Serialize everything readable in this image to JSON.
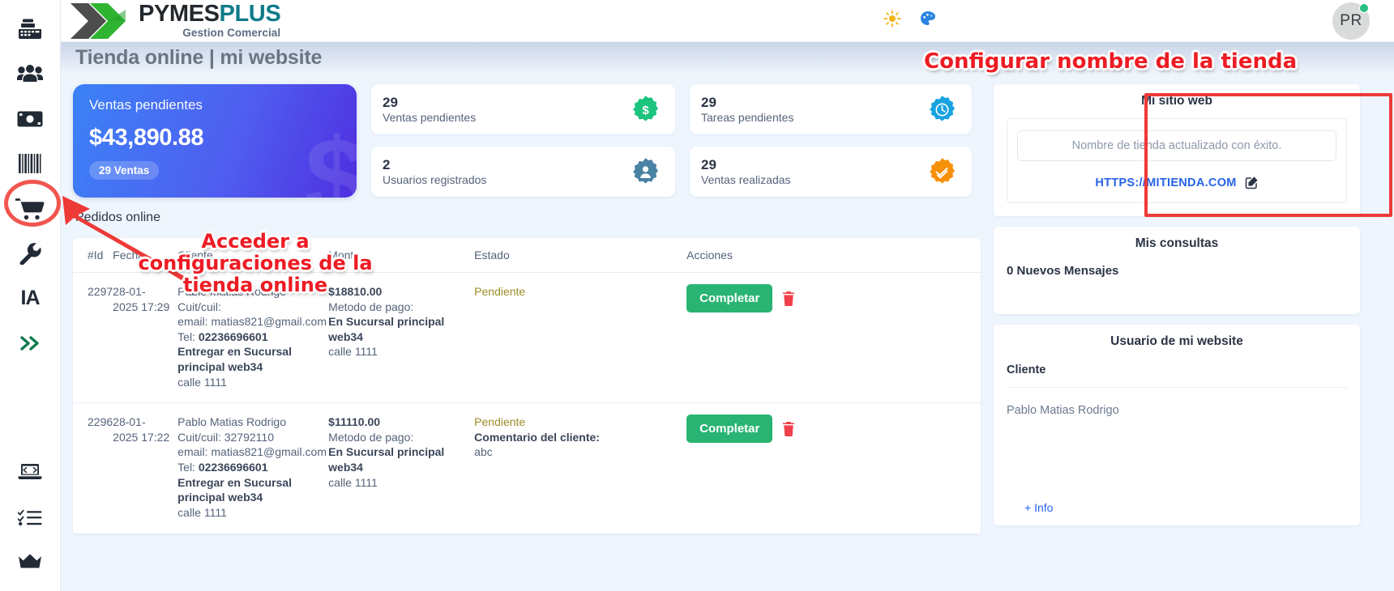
{
  "brand": {
    "name_part1": "PYMES",
    "name_part2": "PLUS",
    "tagline": "Gestion Comercial",
    "logo_icon": "double-chevron-logo-icon"
  },
  "topbar": {
    "theme_icon": "sun-icon",
    "palette_icon": "palette-icon",
    "avatar_initials": "PR",
    "avatar_status": "online"
  },
  "page": {
    "title": "Tienda online | mi website"
  },
  "sidebar": {
    "items": [
      {
        "name": "cash-register-icon",
        "label": "Caja"
      },
      {
        "name": "users-icon",
        "label": "Clientes"
      },
      {
        "name": "money-bill-icon",
        "label": "Ventas"
      },
      {
        "name": "barcode-icon",
        "label": "Productos"
      },
      {
        "name": "shopping-cart-icon",
        "label": "Tienda online",
        "active": true
      },
      {
        "name": "wrench-icon",
        "label": "Configuracion"
      },
      {
        "name": "ia-text-icon",
        "label": "IA"
      },
      {
        "name": "double-chevron-right-icon",
        "label": "Expandir"
      },
      {
        "name": "laptop-code-icon",
        "label": "Desarrollo"
      },
      {
        "name": "checklist-icon",
        "label": "Tareas"
      },
      {
        "name": "crown-icon",
        "label": "Premium"
      }
    ]
  },
  "kpi": {
    "featured": {
      "title": "Ventas pendientes",
      "value": "$43,890.88",
      "chip": "29 Ventas",
      "ghost_glyph": "$"
    },
    "cards": [
      {
        "value": "29",
        "label": "Ventas pendientes",
        "icon": "dollar-badge-icon",
        "color": "#1bc47d"
      },
      {
        "value": "29",
        "label": "Tareas pendientes",
        "icon": "clock-badge-icon",
        "color": "#18a2e0"
      },
      {
        "value": "2",
        "label": "Usuarios registrados",
        "icon": "user-badge-icon",
        "color": "#4a82a3"
      },
      {
        "value": "29",
        "label": "Ventas realizadas",
        "icon": "check-badge-icon",
        "color": "#f79009"
      }
    ]
  },
  "orders": {
    "section_title": "Pedidos online",
    "columns": [
      "#Id",
      "Fecha",
      "Cliente",
      "Monto",
      "Estado",
      "Acciones"
    ],
    "rows": [
      {
        "id": "2297",
        "date_line1": "28-01-",
        "date_line2": "2025 17:29",
        "client_name": "Pablo Matias Rodrigo",
        "client_cuit": "Cuit/cuil:",
        "client_email": "email: matias821@gmail.com",
        "client_tel_label": "Tel:",
        "client_tel": "02236696601",
        "deliver_bold": "Entregar en Sucursal principal web34",
        "deliver_addr": "calle 1111",
        "amount": "$18810.00",
        "pay_label": "Metodo de pago:",
        "pay_method": "En Sucursal principal web34",
        "pay_addr": "calle 1111",
        "status": "Pendiente",
        "comment_label": "",
        "comment_value": "",
        "action_label": "Completar",
        "delete_icon": "trash-icon"
      },
      {
        "id": "2296",
        "date_line1": "28-01-",
        "date_line2": "2025 17:22",
        "client_name": "Pablo Matias Rodrigo",
        "client_cuit": "Cuit/cuil: 32792110",
        "client_email": "email: matias821@gmail.com",
        "client_tel_label": "Tel:",
        "client_tel": "02236696601",
        "deliver_bold": "Entregar en Sucursal principal web34",
        "deliver_addr": "calle 1111",
        "amount": "$11110.00",
        "pay_label": "Metodo de pago:",
        "pay_method": "En Sucursal principal web34",
        "pay_addr": "calle 1111",
        "status": "Pendiente",
        "comment_label": "Comentario del cliente:",
        "comment_value": "abc",
        "action_label": "Completar",
        "delete_icon": "trash-icon"
      }
    ]
  },
  "right_panel": {
    "site": {
      "title": "Mi sitio web",
      "input_value": "Nombre de tienda actualizado con éxito.",
      "url": "HTTPS://MITIENDA.COM",
      "edit_icon": "edit-square-icon"
    },
    "consultas": {
      "title": "Mis consultas",
      "messages": "0 Nuevos Mensajes"
    },
    "usuario": {
      "title": "Usuario de mi website",
      "column_header": "Cliente",
      "client_name": "Pablo Matias Rodrigo",
      "more_link": "+ Info"
    }
  },
  "annotations": [
    {
      "id": "store-name",
      "text": "Configurar nombre de la tienda"
    },
    {
      "id": "access",
      "text": "Acceder a configuraciones de la tienda online"
    }
  ],
  "colors": {
    "accent_blue": "#2563eb",
    "green": "#29b473",
    "annotation_red": "#ed1c24",
    "pending_yellow": "#9a8c28"
  }
}
